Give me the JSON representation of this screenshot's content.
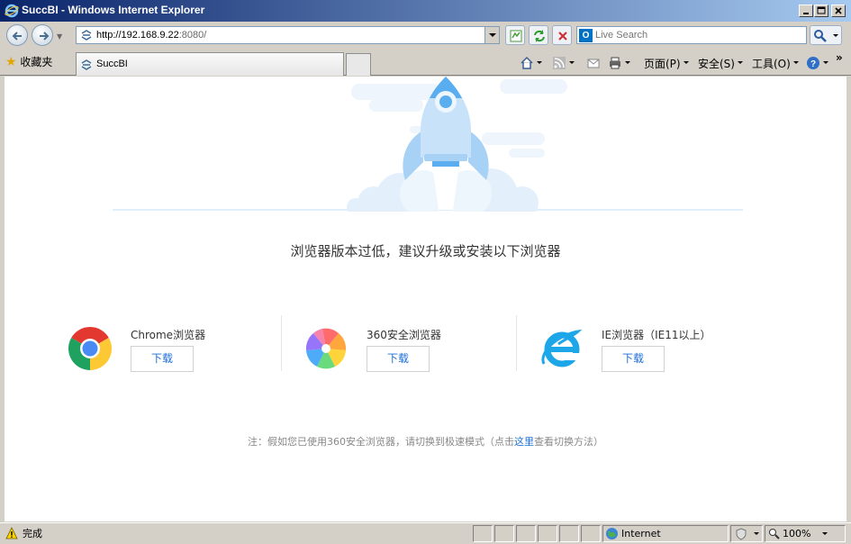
{
  "window": {
    "title": "SuccBI - Windows Internet Explorer"
  },
  "address": {
    "url_host": "http://192.168.9.22",
    "url_port": ":8080/"
  },
  "search": {
    "placeholder": "Live Search",
    "provider_icon": "outlook-icon"
  },
  "favorites": {
    "label": "收藏夹"
  },
  "tab": {
    "label": "SuccBI"
  },
  "commands": {
    "page": "页面(P)",
    "safety": "安全(S)",
    "tools": "工具(O)"
  },
  "content": {
    "headline": "浏览器版本过低，建议升级或安装以下浏览器",
    "browsers": [
      {
        "name": "Chrome浏览器",
        "download": "下载",
        "icon": "chrome-icon"
      },
      {
        "name": "360安全浏览器",
        "download": "下载",
        "icon": "360-browser-icon"
      },
      {
        "name": "IE浏览器（IE11以上）",
        "download": "下载",
        "icon": "ie-icon"
      }
    ],
    "note_prefix": "注：假如您已使用360安全浏览器，请切换到极速模式（点击",
    "note_link": "这里",
    "note_suffix": "查看切换方法）",
    "colors": {
      "accent": "#1e6fd9",
      "rocket": "#5aaef0"
    }
  },
  "status": {
    "text": "完成",
    "zone": "Internet",
    "zoom": "100%"
  }
}
